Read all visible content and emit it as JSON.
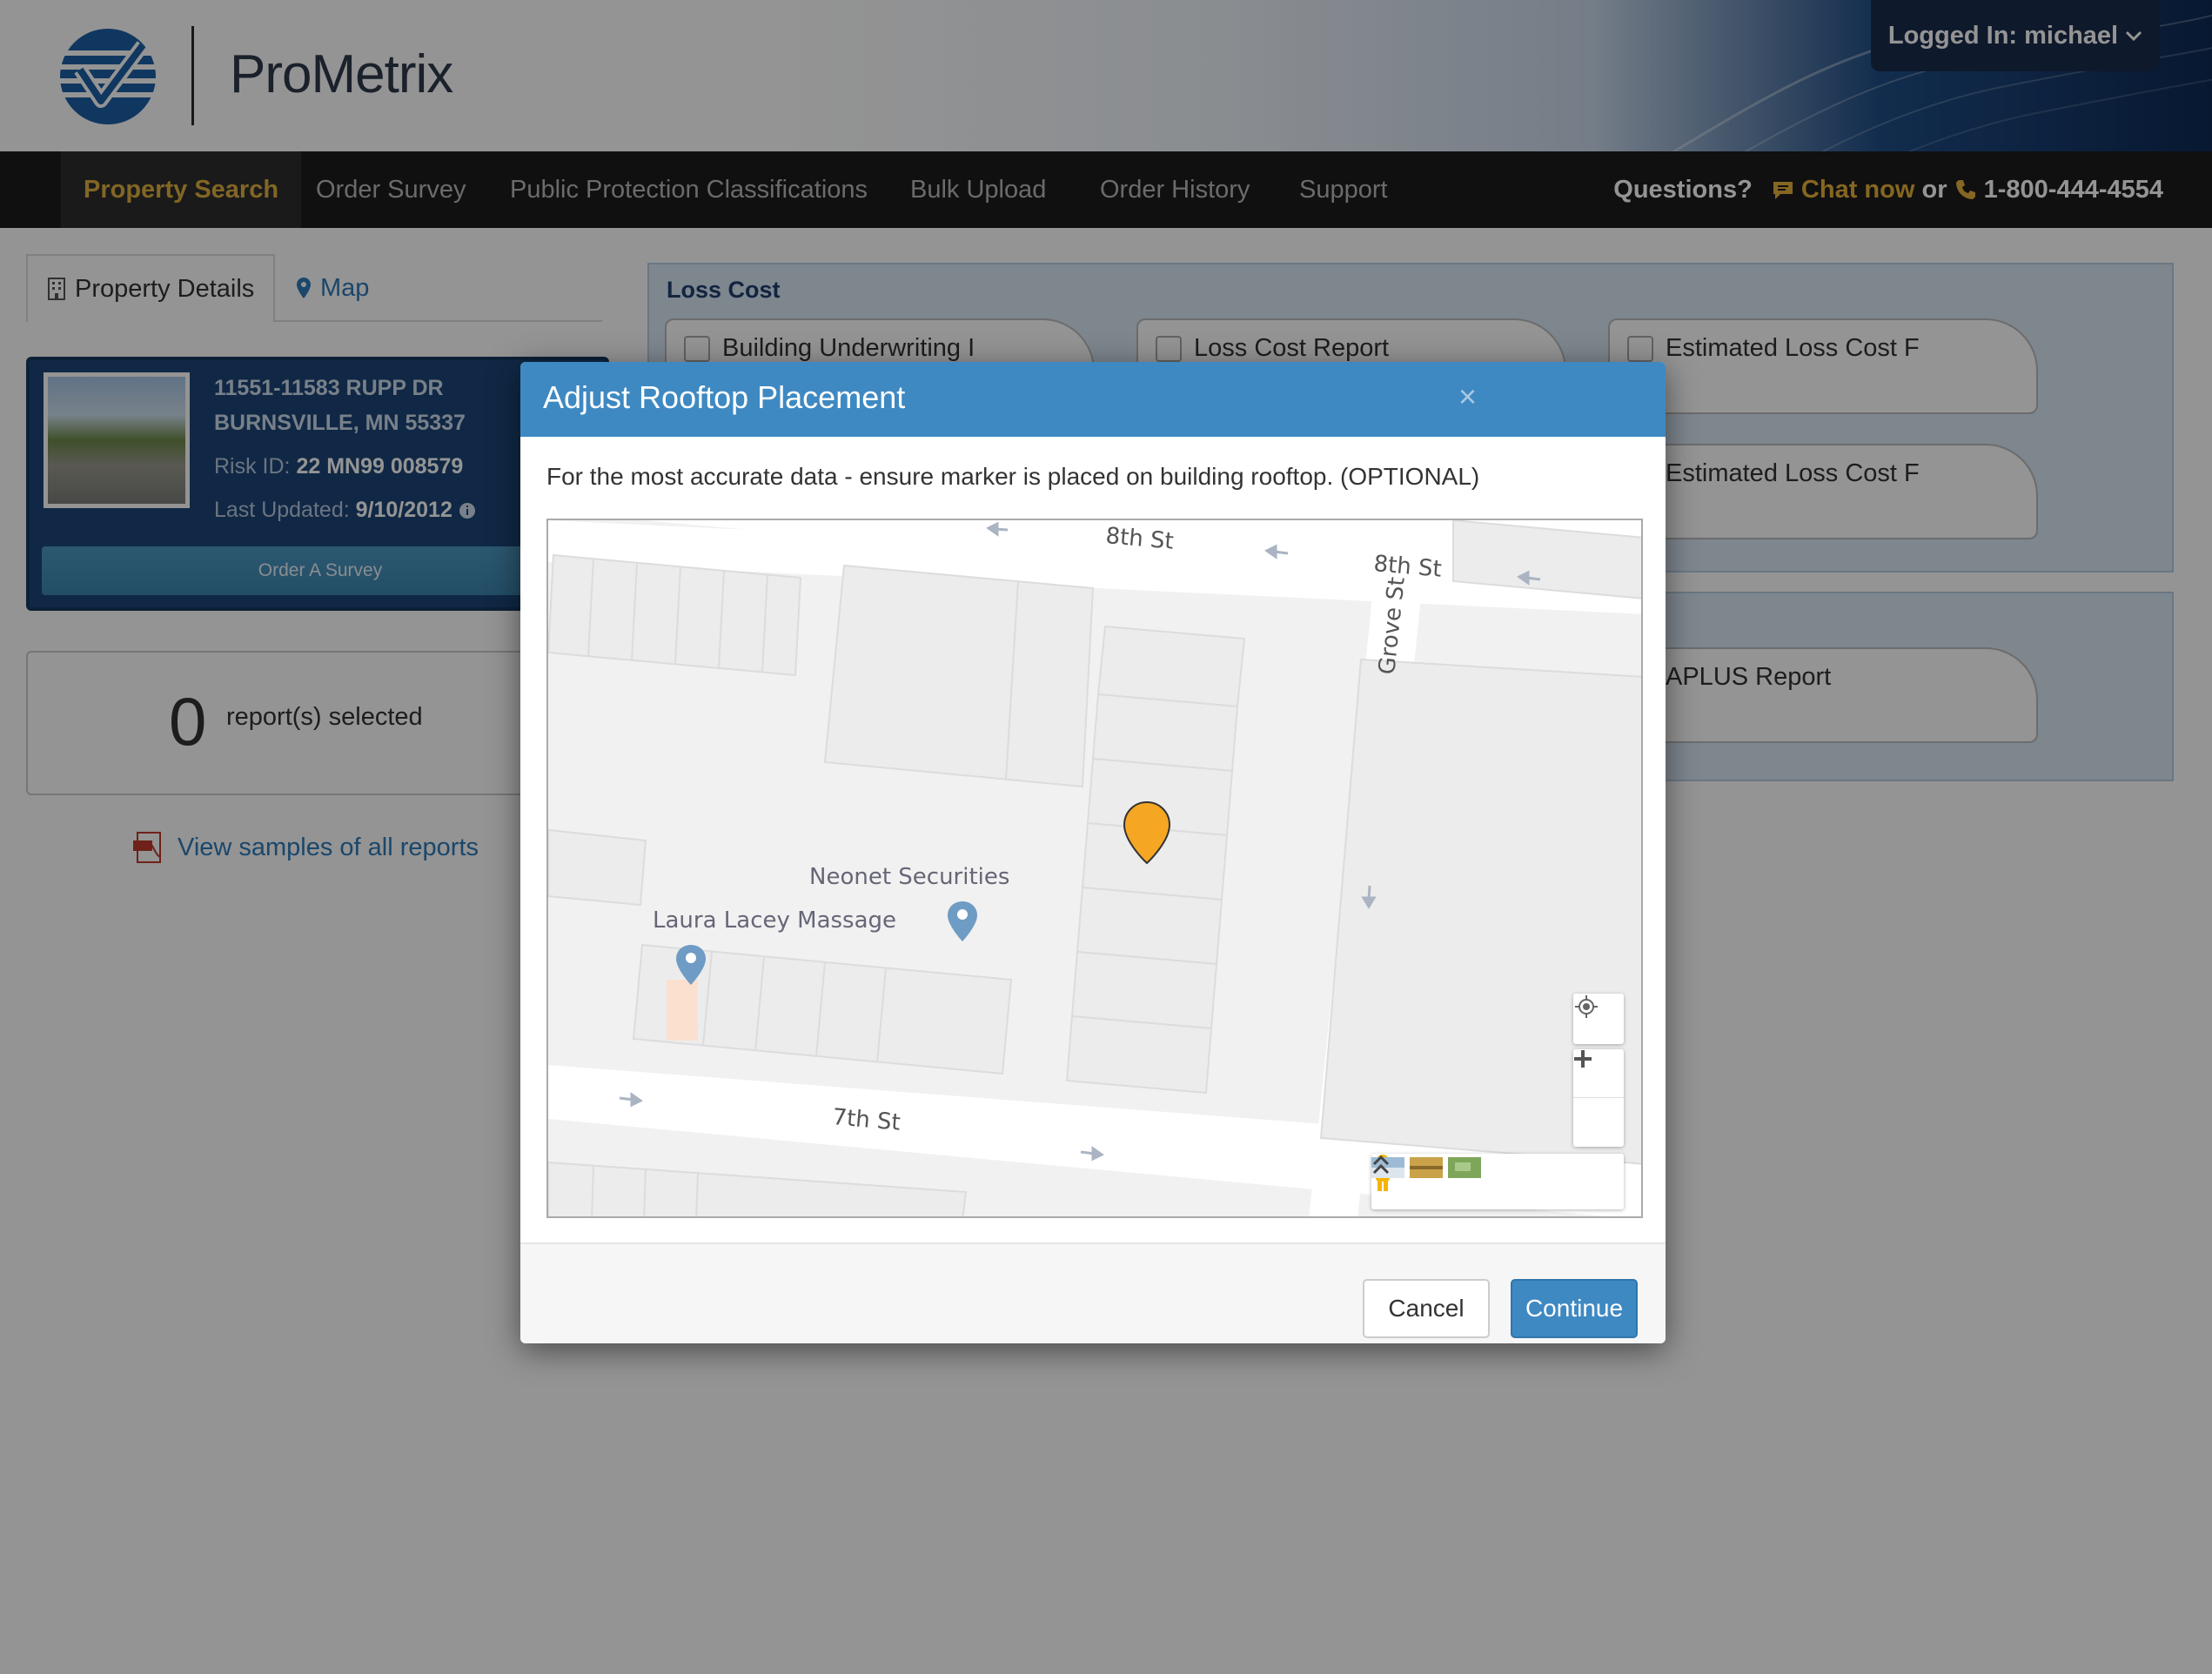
{
  "header": {
    "logo_text": "ProMetrix",
    "user_menu_label": "Logged In: michael"
  },
  "nav": {
    "items": [
      {
        "label": "Property Search"
      },
      {
        "label": "Order Survey"
      },
      {
        "label": "Public Protection Classifications"
      },
      {
        "label": "Bulk Upload"
      },
      {
        "label": "Order History"
      },
      {
        "label": "Support"
      }
    ],
    "questions_label": "Questions?",
    "chat_label": "Chat now",
    "or_label": "or",
    "phone": "1-800-444-4554"
  },
  "left_panel": {
    "tabs": [
      {
        "label": "Property Details",
        "icon": "building-icon"
      },
      {
        "label": "Map",
        "icon": "map-marker-icon"
      }
    ],
    "property": {
      "address_line1": "11551-11583 RUPP DR",
      "address_line2": "BURNSVILLE, MN 55337",
      "risk_id_label": "Risk ID:",
      "risk_id_value": "22 MN99 008579",
      "last_updated_label": "Last Updated:",
      "last_updated_value": "9/10/2012",
      "order_survey_label": "Order A Survey"
    },
    "reports_selected_count": "0",
    "reports_selected_label": "report(s) selected",
    "samples_link": "View samples of all reports"
  },
  "loss_cost": {
    "title": "Loss Cost",
    "tiles": [
      {
        "label": "Building Underwriting I"
      },
      {
        "label": "Loss Cost Report"
      },
      {
        "label": "Estimated Loss Cost F"
      },
      {
        "label": "Estimated Loss Cost F"
      }
    ]
  },
  "second_section": {
    "tiles": [
      {
        "label": "APLUS Report"
      }
    ]
  },
  "modal": {
    "title": "Adjust Rooftop Placement",
    "close_glyph": "×",
    "instructions": "For the most accurate data - ensure marker is placed on building rooftop. (OPTIONAL)",
    "map": {
      "street_labels": [
        "8th St",
        "8th St",
        "Grove St",
        "7th St"
      ],
      "poi_labels": [
        "Neonet Securities",
        "Laura Lacey Massage"
      ],
      "marker_color": "#f5a623"
    },
    "cancel_label": "Cancel",
    "continue_label": "Continue"
  },
  "colors": {
    "accent_gold": "#e0b040",
    "modal_header": "#3f89c2",
    "nav_bg": "#1c1c1c",
    "link_blue": "#2e7ab8"
  }
}
